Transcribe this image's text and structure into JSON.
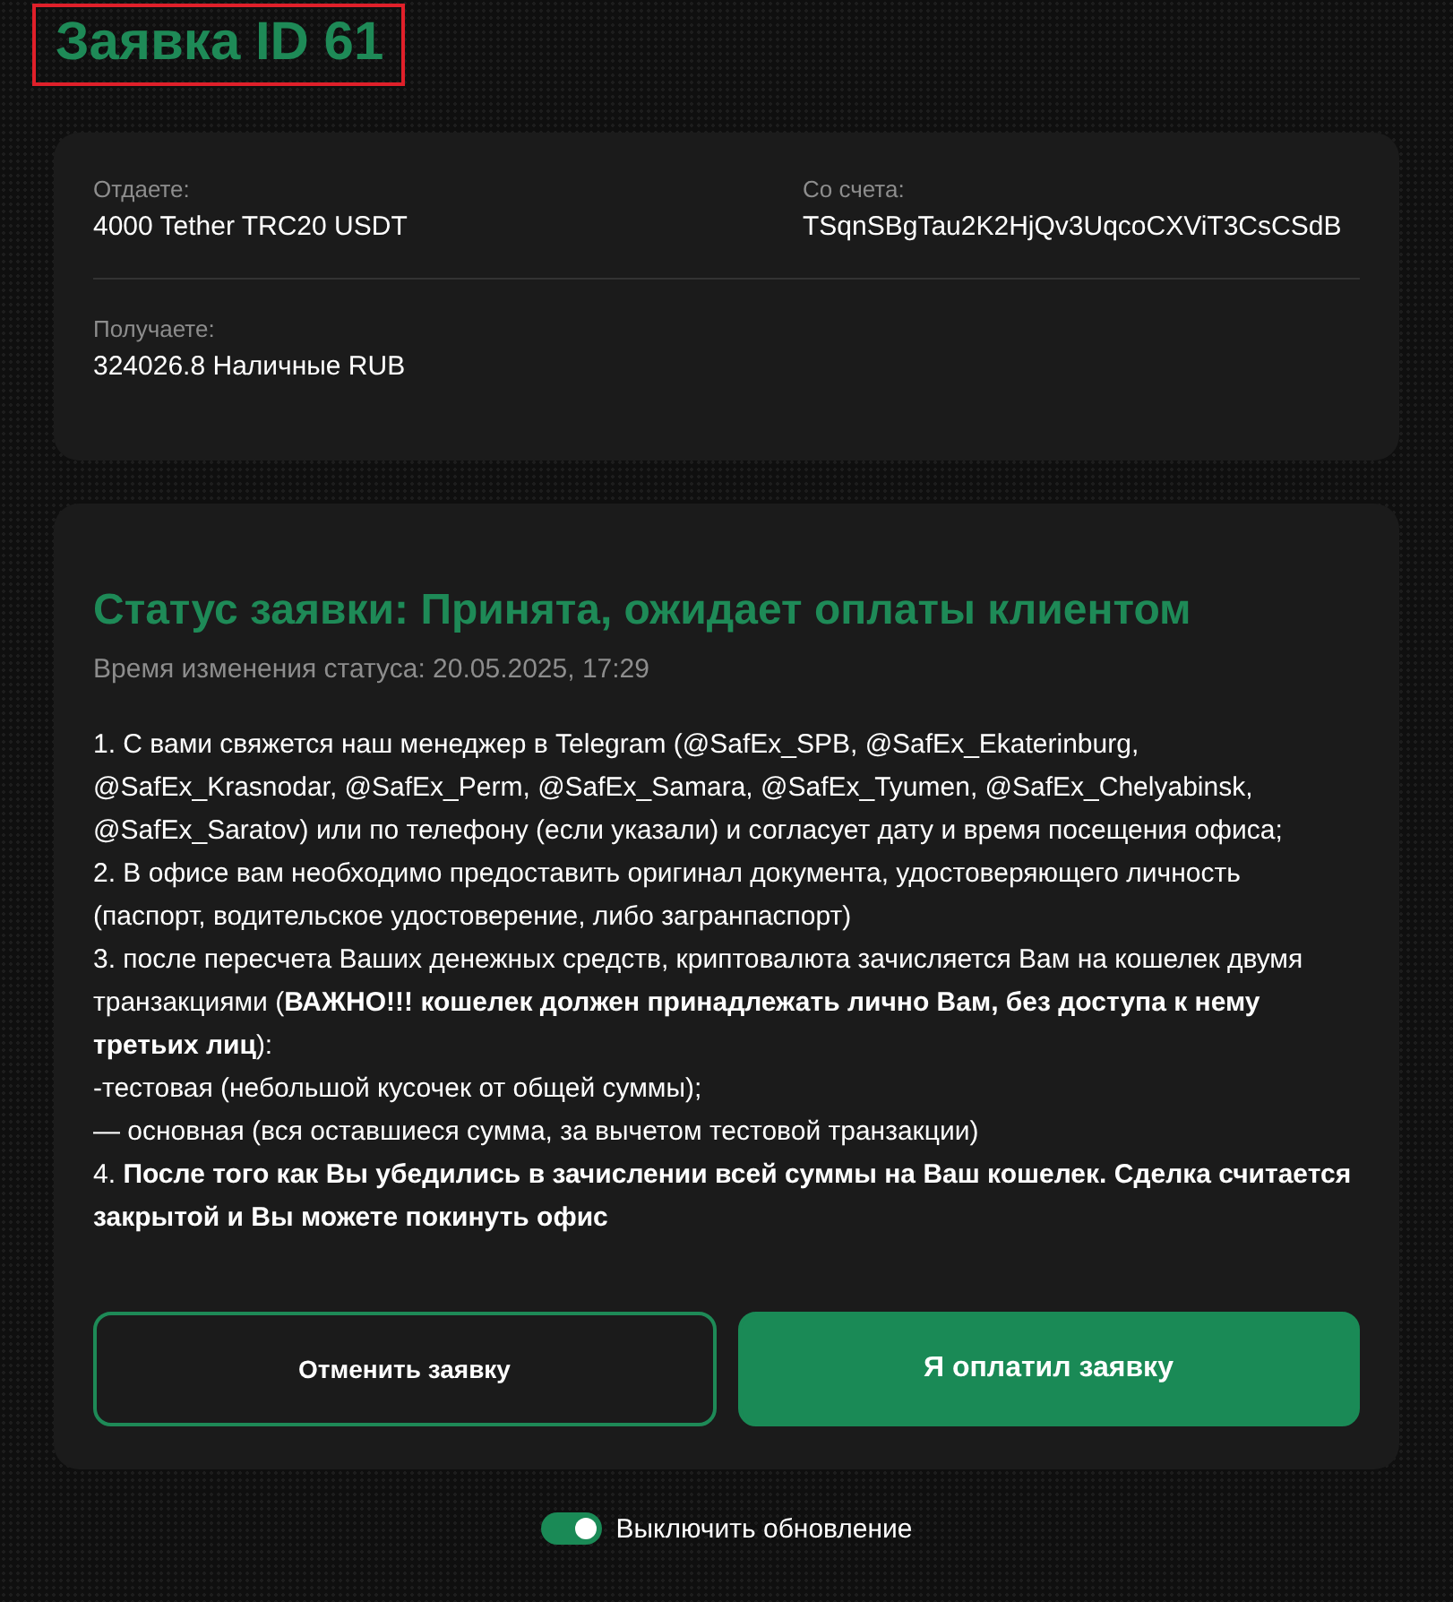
{
  "title": {
    "text": "Заявка ID 61",
    "highlighted": true
  },
  "summary": {
    "fields": [
      {
        "label": "Отдаете:",
        "value": "4000 Tether TRC20 USDT"
      },
      {
        "label": "Со счета:",
        "value": "TSqnSBgTau2K2HjQv3UqcoCXViT3CsCSdB"
      },
      {
        "label": "Получаете:",
        "value": "324026.8 Наличные RUB"
      }
    ]
  },
  "status": {
    "heading": "Статус заявки: Принята, ожидает оплаты клиентом",
    "changed_at": "Время изменения статуса: 20.05.2025, 17:29",
    "instructions": [
      "1. С вами свяжется наш менеджер в Telegram (@SafEx_SPB, @SafEx_Ekaterinburg, @SafEx_Krasnodar, @SafEx_Perm, @SafEx_Samara, @SafEx_Tyumen, @SafEx_Chelyabinsk, @SafEx_Saratov) или по телефону (если указали) и согласует дату и время посещения офиса;",
      "2. В офисе вам необходимо предоставить оригинал документа, удостоверяющего личность (паспорт, водительское удостоверение, либо загранпаспорт)",
      "3. после пересчета Ваших денежных средств, криптовалюта зачисляется Вам на кошелек двумя транзакциями (**ВАЖНО!!! кошелек должен принадлежать лично Вам, без доступа к нему третьих лиц**):",
      "-тестовая (небольшой кусочек от общей суммы);",
      "— основная (вся оставшиеся сумма, за вычетом тестовой транзакции)",
      "4. **После того как Вы убедились в зачислении всей суммы на Ваш кошелек. Сделка считается закрытой и Вы можете покинуть офис**"
    ],
    "buttons": [
      {
        "label": "Отменить заявку",
        "kind": "outline"
      },
      {
        "label": "Я оплатил заявку",
        "kind": "primary"
      }
    ]
  },
  "auto_refresh_toggle": {
    "label": "Выключить обновление",
    "on": true
  }
}
